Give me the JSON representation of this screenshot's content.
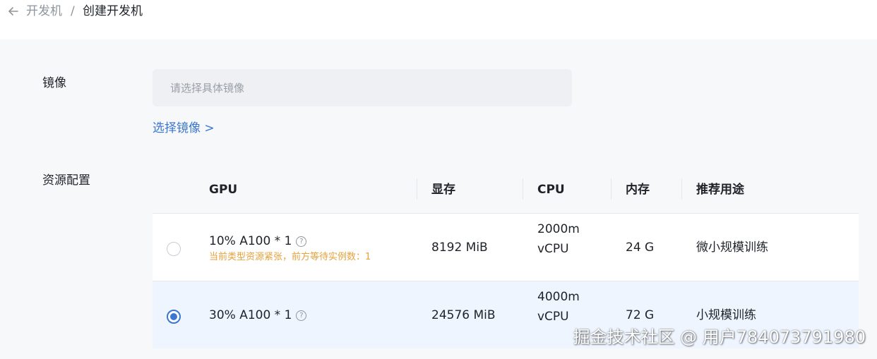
{
  "breadcrumb": {
    "parent": "开发机",
    "separator": "/",
    "current": "创建开发机"
  },
  "form": {
    "image_label": "镜像",
    "image_placeholder": "请选择具体镜像",
    "select_image_link": "选择镜像 >",
    "resource_label": "资源配置"
  },
  "table": {
    "headers": {
      "gpu": "GPU",
      "vram": "显存",
      "cpu": "CPU",
      "ram": "内存",
      "usage": "推荐用途"
    },
    "rows": [
      {
        "gpu": "10% A100 * 1",
        "warning": "当前类型资源紧张，前方等待实例数：1",
        "vram": "8192 MiB",
        "cpu_line1": "2000m",
        "cpu_line2": "vCPU",
        "ram": "24 G",
        "usage": "微小规模训练",
        "selected": false
      },
      {
        "gpu": "30% A100 * 1",
        "warning": "",
        "vram": "24576 MiB",
        "cpu_line1": "4000m",
        "cpu_line2": "vCPU",
        "ram": "72 G",
        "usage": "小规模训练",
        "selected": true
      }
    ]
  },
  "help_glyph": "?",
  "watermark": "掘金技术社区 @ 用户784073791980",
  "colors": {
    "accent": "#3b76d1",
    "warning": "#e6a23c",
    "selected_row": "#eef5ff"
  }
}
